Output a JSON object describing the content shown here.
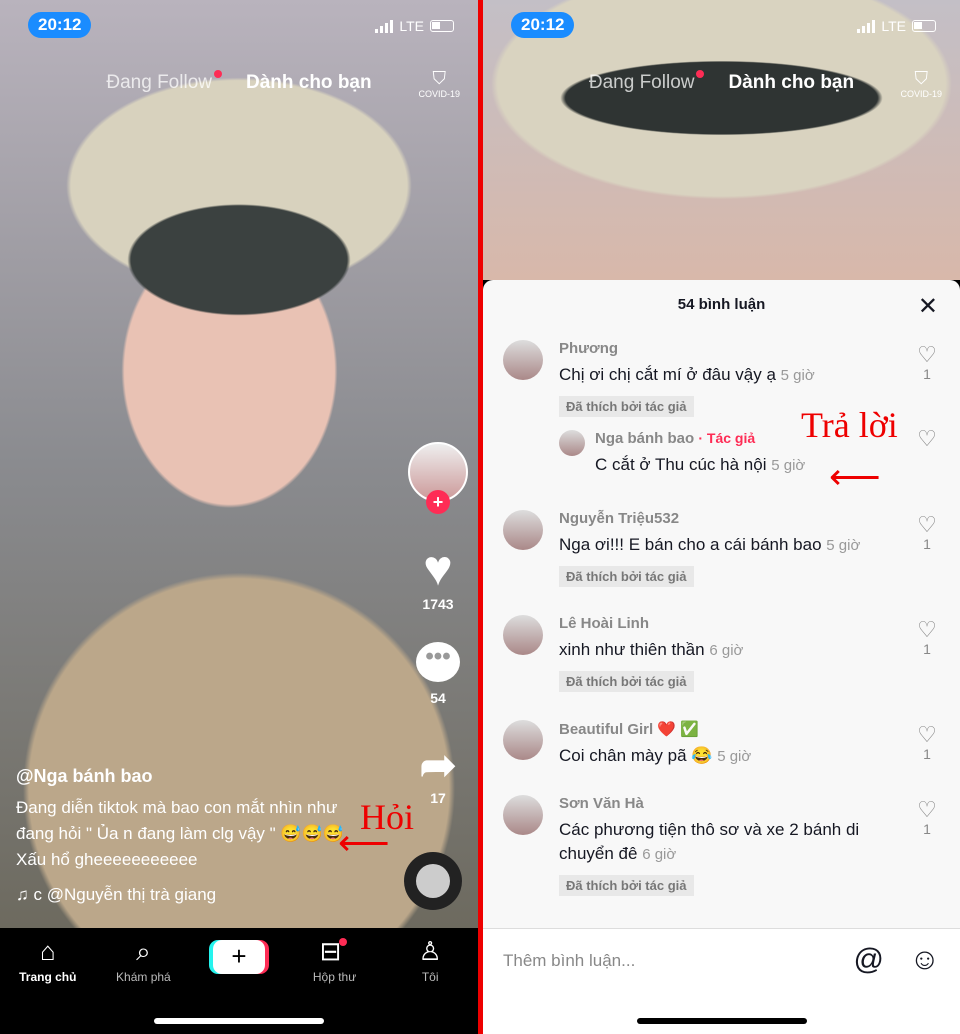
{
  "status": {
    "time": "20:12",
    "network": "LTE"
  },
  "feed_tabs": {
    "following": "Đang Follow",
    "for_you": "Dành cho bạn",
    "covid": "COVID-19"
  },
  "video": {
    "likes": "1743",
    "comments": "54",
    "shares": "17",
    "username": "@Nga bánh bao",
    "description": "Đang diễn tiktok mà bao con mắt nhìn như đang hỏi \" Ủa n đang làm clg vậy \" 😅😅😅 Xấu hổ gheeeeeeeeeee",
    "music": "c   @Nguyễn thị trà giang"
  },
  "annotations": {
    "left": "Hỏi",
    "right": "Trả lời",
    "color": "#e00000"
  },
  "nav": [
    {
      "label": "Trang chủ",
      "icon": "home-icon"
    },
    {
      "label": "Khám phá",
      "icon": "search-icon"
    },
    {
      "label": "",
      "icon": "create-icon"
    },
    {
      "label": "Hộp thư",
      "icon": "inbox-icon"
    },
    {
      "label": "Tôi",
      "icon": "profile-icon"
    }
  ],
  "comments_panel": {
    "title": "54 bình luận",
    "input_placeholder": "Thêm bình luận...",
    "liked_by_author": "Đã thích bởi tác giả",
    "comments": [
      {
        "name": "Phương",
        "text": "Chị ơi chị cắt mí ở đâu vậy ạ",
        "time": "5 giờ",
        "likes": "1"
      },
      {
        "name": "Nga bánh bao",
        "author_tag": "· Tác giả",
        "text": "C cắt ở Thu cúc hà nội",
        "time": "5 giờ",
        "likes": ""
      },
      {
        "name": "Nguyễn Triệu532",
        "text": "Nga ơi!!! E bán cho a cái bánh bao",
        "time": "5 giờ",
        "likes": "1"
      },
      {
        "name": "Lê Hoài Linh",
        "text": "xinh như thiên thần",
        "time": "6 giờ",
        "likes": "1"
      },
      {
        "name": "Beautiful Girl ❤️ ✅",
        "text": "Coi chân mày pã 😂",
        "time": "5 giờ",
        "likes": "1"
      },
      {
        "name": "Sơn Văn Hà",
        "text": "Các phương tiện thô sơ và xe 2 bánh di chuyển đê",
        "time": "6 giờ",
        "likes": "1"
      }
    ]
  },
  "colors": {
    "accent": "#fe2c55",
    "time_pill": "#1a8cff"
  }
}
